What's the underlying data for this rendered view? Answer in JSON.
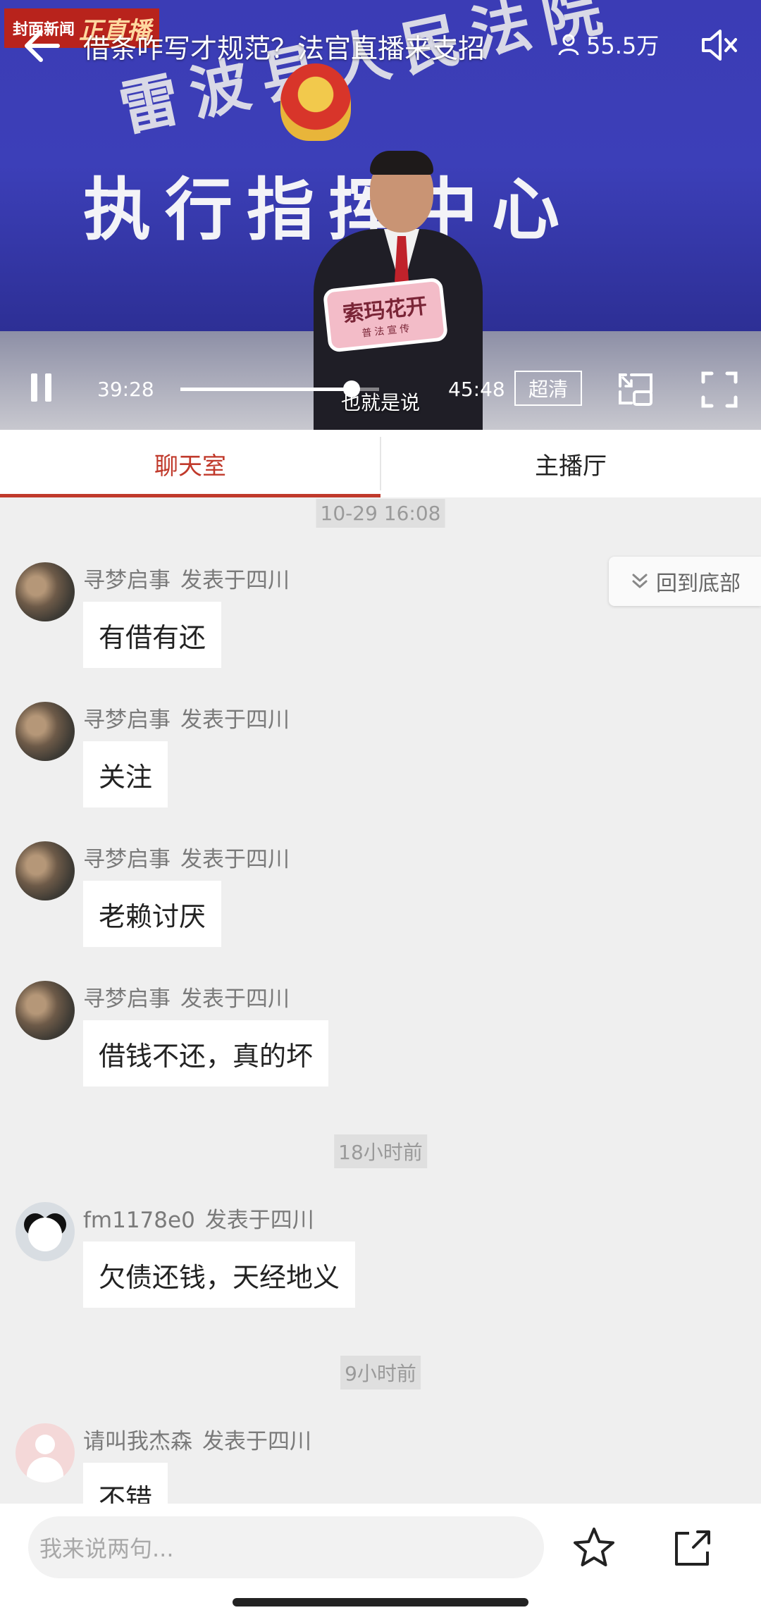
{
  "video": {
    "channel_tag": "封面新闻",
    "channel_live": "正直播",
    "title": "借条咋写才规范？法官直播来支招",
    "viewers": "55.5万",
    "scene_court_name": "雷波县人民法院",
    "scene_center_title": "执行指挥中心",
    "sign_text": "索玛花开",
    "sign_subtext": "普法宣传",
    "subtitle": "也就是说",
    "current_time": "39:28",
    "duration": "45:48",
    "progress_fraction": 0.862,
    "quality_label": "超清"
  },
  "tabs": [
    {
      "label": "聊天室",
      "active": true
    },
    {
      "label": "主播厅",
      "active": false
    }
  ],
  "chat": {
    "back_to_bottom": "回到底部",
    "items": [
      {
        "kind": "timestamp",
        "text": "10-29 16:08"
      },
      {
        "kind": "message",
        "user": "寻梦启事",
        "location": "发表于四川",
        "text": "有借有还",
        "avatar": "photo"
      },
      {
        "kind": "message",
        "user": "寻梦启事",
        "location": "发表于四川",
        "text": "关注",
        "avatar": "photo"
      },
      {
        "kind": "message",
        "user": "寻梦启事",
        "location": "发表于四川",
        "text": "老赖讨厌",
        "avatar": "photo"
      },
      {
        "kind": "message",
        "user": "寻梦启事",
        "location": "发表于四川",
        "text": "借钱不还，真的坏",
        "avatar": "photo"
      },
      {
        "kind": "timestamp",
        "text": "18小时前"
      },
      {
        "kind": "message",
        "user": "fm1178e0",
        "location": "发表于四川",
        "text": "欠债还钱，天经地义",
        "avatar": "panda"
      },
      {
        "kind": "timestamp",
        "text": "9小时前"
      },
      {
        "kind": "message",
        "user": "请叫我杰森",
        "location": "发表于四川",
        "text": "不错",
        "avatar": "default"
      }
    ]
  },
  "input": {
    "placeholder": "我来说两句..."
  },
  "colors": {
    "accent": "#c0392b",
    "chat_background": "#efefef"
  },
  "icons": [
    "back-arrow-icon",
    "person-icon",
    "mute-icon",
    "pause-icon",
    "pip-icon",
    "fullscreen-icon",
    "double-chevron-down-icon",
    "star-icon",
    "share-icon"
  ]
}
